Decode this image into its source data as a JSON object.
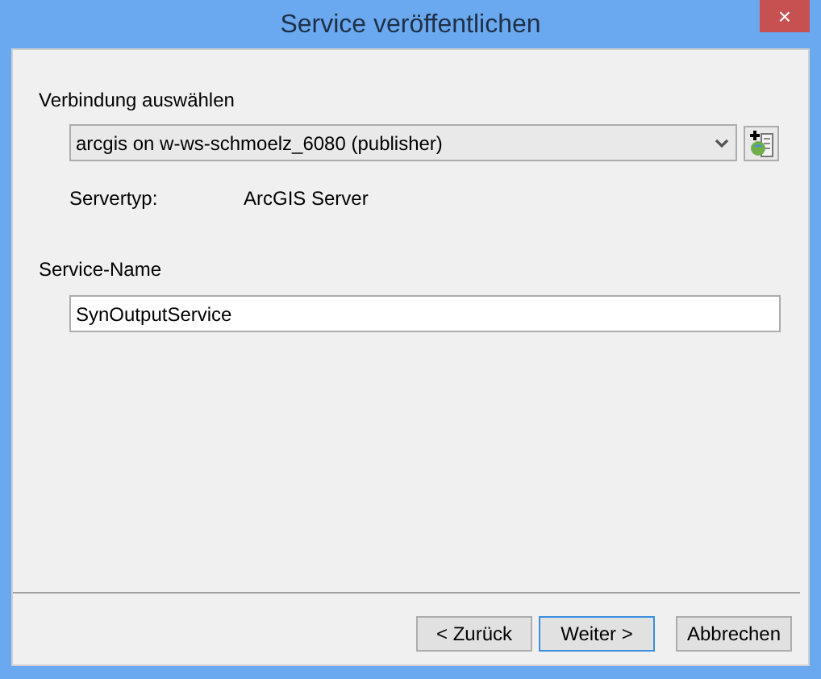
{
  "window": {
    "title": "Service veröffentlichen",
    "close": "×"
  },
  "connection": {
    "label": "Verbindung auswählen",
    "value": "arcgis on w-ws-schmoelz_6080 (publisher)"
  },
  "server_type": {
    "label": "Servertyp:",
    "value": "ArcGIS Server"
  },
  "service_name": {
    "label": "Service-Name",
    "value": "SynOutputService"
  },
  "buttons": [
    {
      "label": "< Zurück",
      "default": false
    },
    {
      "label": "Weiter >",
      "default": true
    },
    {
      "label": "Abbrechen",
      "default": false
    }
  ]
}
